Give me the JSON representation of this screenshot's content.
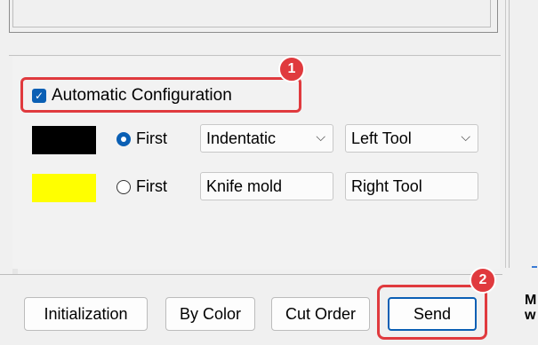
{
  "config": {
    "auto_label": "Automatic Configuration",
    "checked": true
  },
  "rows": [
    {
      "swatch_color": "#000000",
      "radio_label": "First",
      "radio_selected": true,
      "process": "Indentatic",
      "tool": "Left Tool"
    },
    {
      "swatch_color": "#FFFF00",
      "radio_label": "First",
      "radio_selected": false,
      "process": "Knife mold",
      "tool": "Right Tool"
    }
  ],
  "callouts": {
    "badge1": "1",
    "badge2": "2",
    "accent": "#E03A3E"
  },
  "buttons": {
    "initialization": "Initialization",
    "by_color": "By Color",
    "cut_order": "Cut Order",
    "send": "Send"
  },
  "side_text": "M\nw"
}
